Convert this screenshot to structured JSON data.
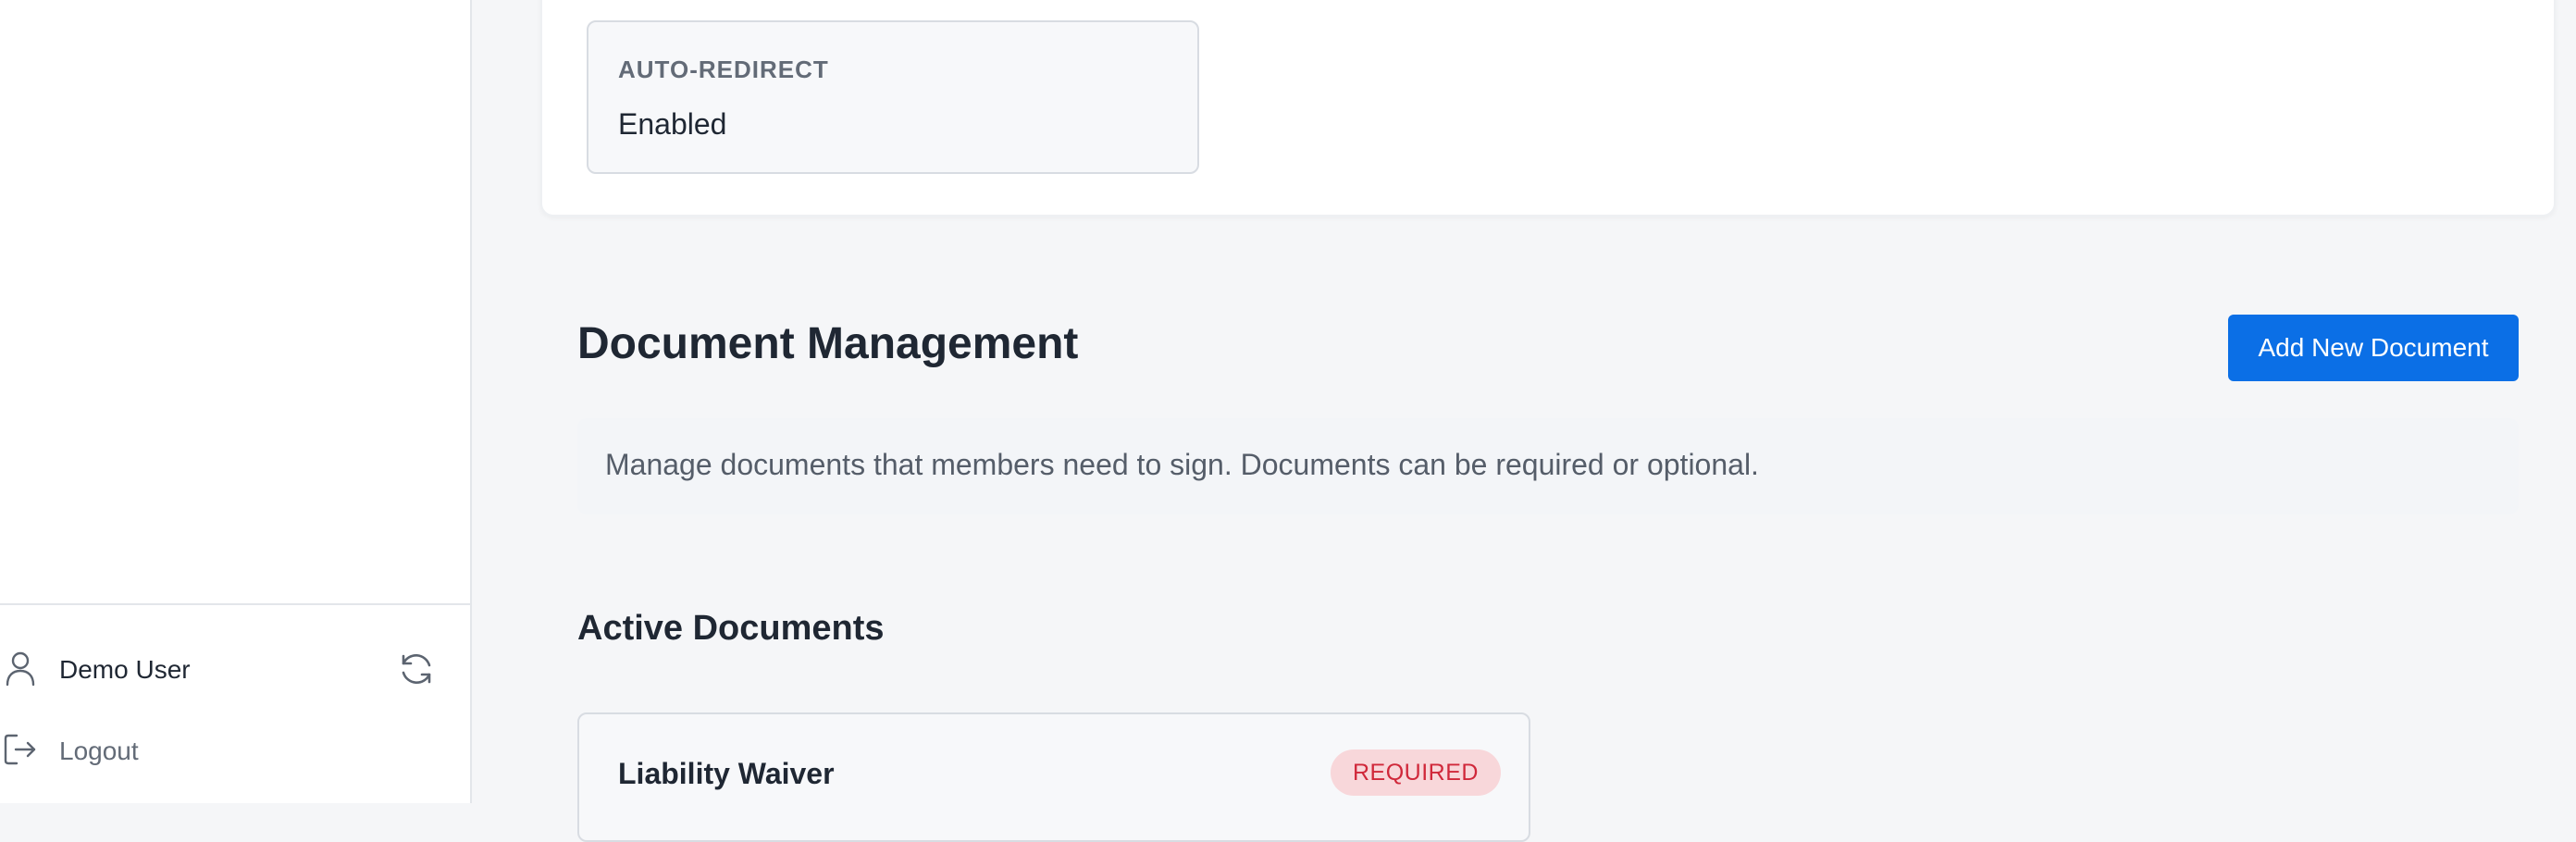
{
  "sidebar": {
    "user_name": "Demo User",
    "logout_label": "Logout",
    "icons": {
      "user": "user-icon",
      "refresh": "refresh-icon",
      "logout": "logout-icon"
    }
  },
  "settings_card": {
    "auto_redirect_label": "AUTO-REDIRECT",
    "auto_redirect_value": "Enabled"
  },
  "document_management": {
    "title": "Document Management",
    "add_button_label": "Add New Document",
    "description": "Manage documents that members need to sign. Documents can be required or optional.",
    "active_documents_title": "Active Documents",
    "documents": [
      {
        "name": "Liability Waiver",
        "badge": "REQUIRED"
      }
    ]
  },
  "colors": {
    "accent": "#0b6fe6",
    "required_badge_bg": "#f8d7da",
    "required_badge_text": "#d0283a"
  }
}
